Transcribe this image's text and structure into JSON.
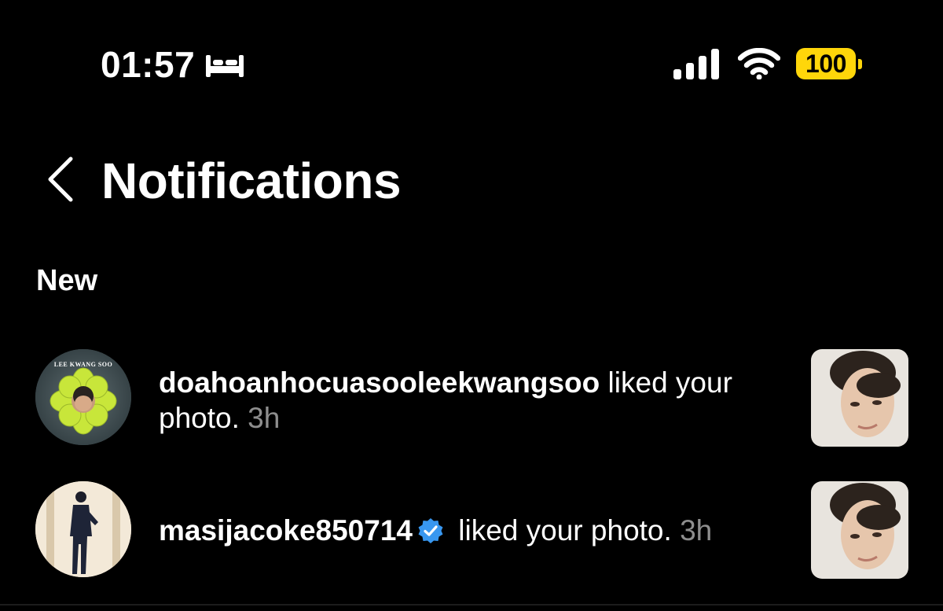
{
  "status_bar": {
    "time": "01:57",
    "battery_level": "100",
    "icons": [
      "bed-icon",
      "signal-icon",
      "wifi-icon",
      "battery-icon"
    ],
    "battery_color": "#FFD60A"
  },
  "header": {
    "title": "Notifications"
  },
  "section": {
    "label": "New"
  },
  "notifications": [
    {
      "username": "doahoanhocuasooleekwangsoo",
      "action": " liked your photo.",
      "time": " 3h",
      "verified": false,
      "avatar_text": "LEE KWANG SOO"
    },
    {
      "username": "masijacoke850714",
      "action": " liked your photo.",
      "time": " 3h",
      "verified": true
    }
  ],
  "colors": {
    "background": "#000000",
    "text": "#FFFFFF",
    "secondary_text": "#8E8E8E",
    "verified_blue": "#3897F0"
  }
}
